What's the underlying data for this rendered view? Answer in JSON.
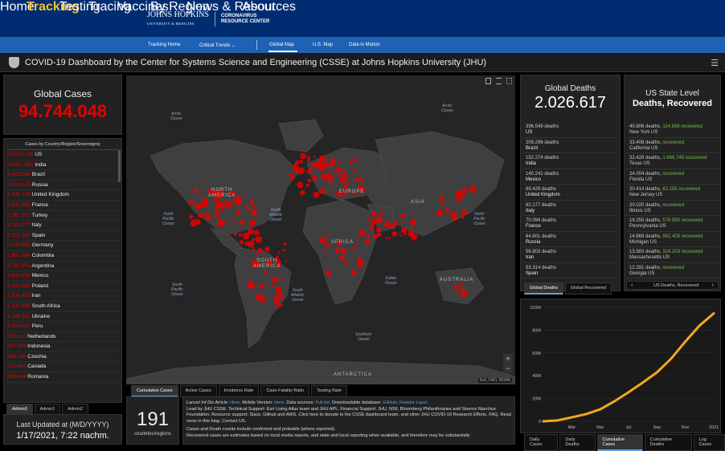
{
  "topnav": {
    "logo_main": "JOHNS HOPKINS",
    "logo_sub": "UNIVERSITY & MEDICINE",
    "logo_crc_line1": "CORONAVIRUS",
    "logo_crc_line2": "RESOURCE CENTER",
    "items": [
      {
        "label": "Home",
        "active": false
      },
      {
        "label": "Tracking",
        "active": true
      },
      {
        "label": "Testing",
        "active": false
      },
      {
        "label": "Tracing",
        "active": false
      },
      {
        "label": "Vaccines",
        "active": false
      },
      {
        "label": "By Region",
        "active": false
      },
      {
        "label": "News & Resources",
        "active": false
      },
      {
        "label": "About",
        "active": false
      }
    ]
  },
  "subnav": {
    "items": [
      {
        "label": "Tracking Home"
      },
      {
        "label": "Critical Trends ⌄"
      },
      {
        "label": "Global Map"
      },
      {
        "label": "U.S. Map"
      },
      {
        "label": "Data in Motion"
      }
    ]
  },
  "dashboard_title": "COVID-19 Dashboard by the Center for Systems Science and Engineering (CSSE) at Johns Hopkins University (JHU)",
  "global_cases": {
    "label": "Global Cases",
    "value": "94.744.048"
  },
  "cases_list": {
    "header": "Cases by Country/Region/Sovereignty",
    "rows": [
      {
        "value": "23.819.290",
        "name": "US"
      },
      {
        "value": "10.557.985",
        "name": "India"
      },
      {
        "value": "8.455.059",
        "name": "Brazil"
      },
      {
        "value": "3.530.379",
        "name": "Russia"
      },
      {
        "value": "3.485.716",
        "name": "United Kingdom"
      },
      {
        "value": "2.931.865",
        "name": "France"
      },
      {
        "value": "2.387.101",
        "name": "Turkey"
      },
      {
        "value": "2.381.277",
        "name": "Italy"
      },
      {
        "value": "2.252.164",
        "name": "Spain"
      },
      {
        "value": "2.049.855",
        "name": "Germany"
      },
      {
        "value": "1.891.034",
        "name": "Colombia"
      },
      {
        "value": "1.791.979",
        "name": "Argentina"
      },
      {
        "value": "1.630.258",
        "name": "Mexico"
      },
      {
        "value": "1.435.582",
        "name": "Poland"
      },
      {
        "value": "1.330.411",
        "name": "Iran"
      },
      {
        "value": "1.325.659",
        "name": "South Africa"
      },
      {
        "value": "1.198.512",
        "name": "Ukraine"
      },
      {
        "value": "1.056.023",
        "name": "Peru"
      },
      {
        "value": "925.310",
        "name": "Netherlands"
      },
      {
        "value": "907.929",
        "name": "Indonesia"
      },
      {
        "value": "889.159",
        "name": "Czechia"
      },
      {
        "value": "710.616",
        "name": "Canada"
      },
      {
        "value": "693.644",
        "name": "Romania"
      }
    ],
    "tabs": [
      {
        "label": "Admin0",
        "active": true
      },
      {
        "label": "Admin1",
        "active": false
      },
      {
        "label": "Admin2",
        "active": false
      }
    ]
  },
  "last_updated": {
    "label": "Last Updated at (M/D/YYYY)",
    "value": "1/17/2021, 7:22 nachm."
  },
  "countries_count": {
    "value": "191",
    "label": "countries/regions"
  },
  "map": {
    "oceans": [
      {
        "text": "Arctic\nOcean"
      },
      {
        "text": "Arctic\nOcean"
      },
      {
        "text": "North\nPacific\nOcean"
      },
      {
        "text": "North\nAtlantic\nOcean"
      },
      {
        "text": "North\nPacific\nOcean"
      },
      {
        "text": "South\nPacific\nOcean"
      },
      {
        "text": "South\nAtlantic\nOcean"
      },
      {
        "text": "Indian\nOcean"
      },
      {
        "text": "Southern\nOcean"
      }
    ],
    "continents": [
      {
        "text": "NORTH\nAMERICA"
      },
      {
        "text": "SOUTH\nAMERICA"
      },
      {
        "text": "EUROPE"
      },
      {
        "text": "ASIA"
      },
      {
        "text": "AFRICA"
      },
      {
        "text": "AUSTRALIA"
      },
      {
        "text": "ANTARCTICA"
      }
    ],
    "attribution": "Esri, FAO, NOAA",
    "tabs": [
      {
        "label": "Cumulative Cases",
        "active": true
      },
      {
        "label": "Active Cases",
        "active": false
      },
      {
        "label": "Incidence Rate",
        "active": false
      },
      {
        "label": "Case-Fatality Ratio",
        "active": false
      },
      {
        "label": "Testing Rate",
        "active": false
      }
    ]
  },
  "info_text": {
    "p1_a": "Lancet Inf Dis",
    "p1_b": " Article: ",
    "p1_c": "Here",
    "p1_d": ". Mobile Version: ",
    "p1_e": "Here",
    "p1_f": ". Data sources: ",
    "p1_g": "Full list",
    "p1_h": ". Downloadable database: ",
    "p1_i": "GitHub",
    "p1_j": ", ",
    "p1_k": "Feature Layer",
    "p1_l": ".",
    "p2": "Lead by JHU CSSE. Technical Support: Esri Living Atlas team and JHU APL. Financial Support: JHU, NSF, Bloomberg Philanthropies and Stavros Niarchos Foundation. Resource support: Slack, Github and AWS. Click here to donate to the CSSE dashboard team, and other JHU COVID-19 Research Efforts. FAQ. Read more in this blog. Contact US.",
    "p3": "Cases and Death counts include confirmed and probable (where reported).",
    "p4": "Recovered cases are estimates based on local media reports, and state and local reporting when available, and therefore may be substantially"
  },
  "global_deaths": {
    "label": "Global Deaths",
    "value": "2.026.617",
    "rows": [
      {
        "deaths": "396.549 deaths",
        "name": "US"
      },
      {
        "deaths": "209.296 deaths",
        "name": "Brazil"
      },
      {
        "deaths": "152.274 deaths",
        "name": "India"
      },
      {
        "deaths": "140.241 deaths",
        "name": "Mexico"
      },
      {
        "deaths": "89.429 deaths",
        "name": "United Kingdom"
      },
      {
        "deaths": "82.177 deaths",
        "name": "Italy"
      },
      {
        "deaths": "70.094 deaths",
        "name": "France"
      },
      {
        "deaths": "64.601 deaths",
        "name": "Russia"
      },
      {
        "deaths": "56.803 deaths",
        "name": "Iran"
      },
      {
        "deaths": "53.314 deaths",
        "name": "Spain"
      }
    ],
    "tabs": [
      {
        "label": "Global Deaths",
        "active": true
      },
      {
        "label": "Global Recovered",
        "active": false
      }
    ]
  },
  "us_state": {
    "label_line1": "US State Level",
    "label_line2": "Deaths, Recovered",
    "rows": [
      {
        "deaths": "40.806 deaths, ",
        "recovered": "114.868 recovered",
        "name": "New York US"
      },
      {
        "deaths": "33.408 deaths, ",
        "recovered": " recovered",
        "name": "California US"
      },
      {
        "deaths": "32.428 deaths, ",
        "recovered": "1.666.745 recovered",
        "name": "Texas US"
      },
      {
        "deaths": "24.004 deaths, ",
        "recovered": " recovered",
        "name": "Florida US"
      },
      {
        "deaths": "20.414 deaths, ",
        "recovered": "62.155 recovered",
        "name": "New Jersey US"
      },
      {
        "deaths": "20.020 deaths, ",
        "recovered": " recovered",
        "name": "Illinois US"
      },
      {
        "deaths": "19.255 deaths, ",
        "recovered": "578.950 recovered",
        "name": "Pennsylvania US"
      },
      {
        "deaths": "14.669 deaths, ",
        "recovered": "662.408 recovered",
        "name": "Michigan US"
      },
      {
        "deaths": "13.583 deaths, ",
        "recovered": "324.203 recovered",
        "name": "Massachusetts US"
      },
      {
        "deaths": "12.291 deaths, ",
        "recovered": " recovered",
        "name": "Georgia US"
      }
    ],
    "pager_prev": "‹",
    "pager_label": "US Deaths, Recovered",
    "pager_next": "›"
  },
  "chart_tabs": [
    {
      "label": "Daily Cases",
      "active": false
    },
    {
      "label": "Daily Deaths",
      "active": false
    },
    {
      "label": "Cumulative Cases",
      "active": true
    },
    {
      "label": "Cumulative Deaths",
      "active": false
    },
    {
      "label": "Log Cases",
      "active": false
    }
  ],
  "chart_data": {
    "type": "line",
    "title": "",
    "xlabel": "",
    "ylabel": "",
    "x_tick_labels": [
      "Mär",
      "Mai",
      "Jul",
      "Sep",
      "Nov",
      "2021"
    ],
    "x": [
      0,
      1,
      2,
      3,
      4,
      5,
      6,
      7,
      8,
      9,
      10,
      11,
      12
    ],
    "y_tick_labels": [
      "0",
      "20M",
      "40M",
      "60M",
      "80M",
      "100M"
    ],
    "ylim": [
      0,
      100000000
    ],
    "series": [
      {
        "values": [
          0,
          800000,
          3500000,
          6300000,
          10500000,
          17500000,
          25500000,
          34000000,
          43000000,
          55000000,
          70000000,
          84000000,
          94744048
        ]
      }
    ],
    "color": "#f4a81d",
    "grid": true
  },
  "colors": {
    "accent_red": "#e60000",
    "recovered_green": "#6ec04a",
    "nav_blue": "#002d72",
    "subnav_blue": "#1f61b3",
    "tracking_yellow": "#f2c12e"
  }
}
